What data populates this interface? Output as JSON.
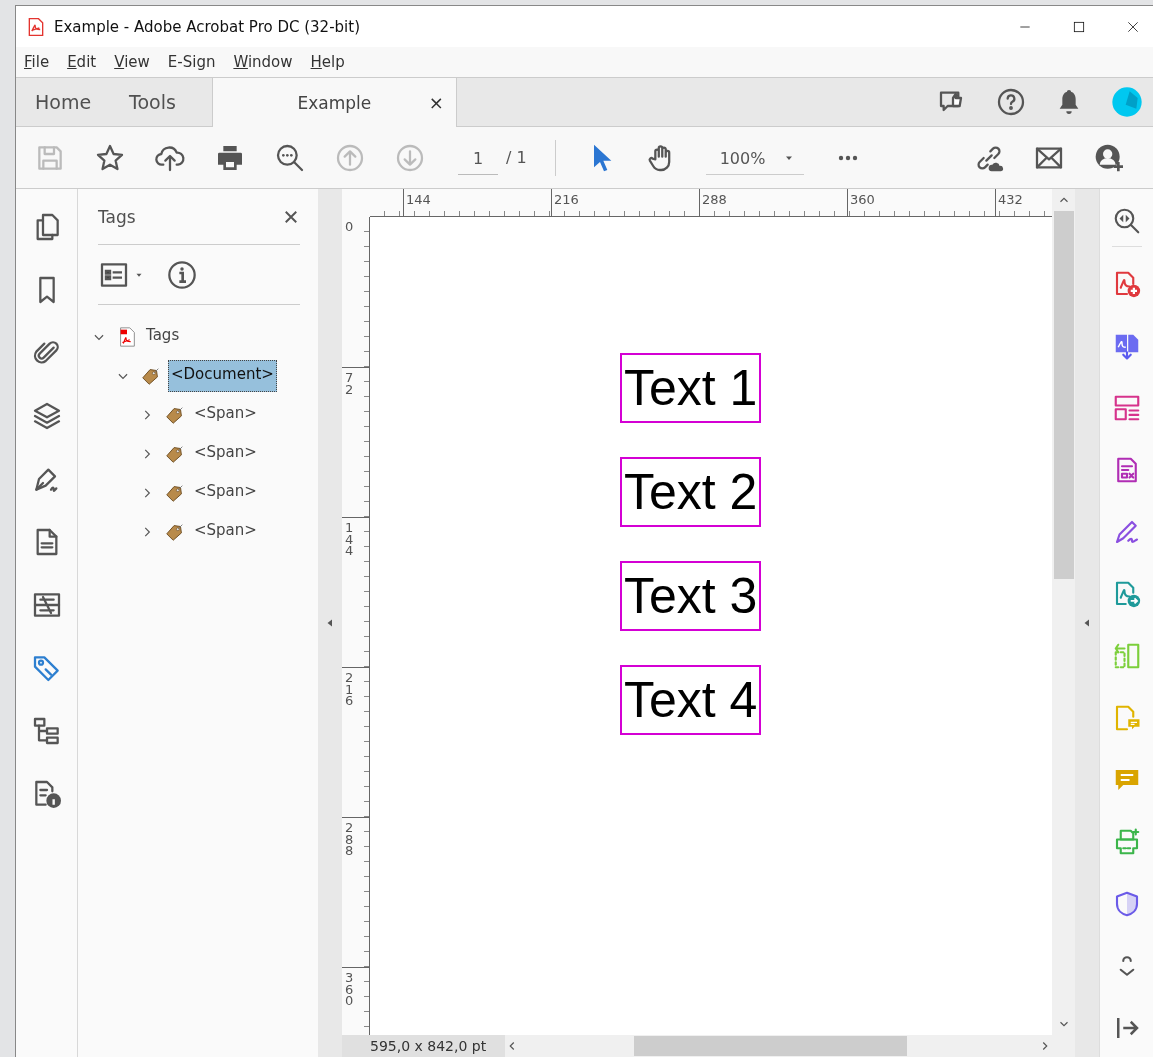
{
  "window": {
    "title": "Example - Adobe Acrobat Pro DC (32-bit)"
  },
  "menu": [
    {
      "label": "File",
      "mnemonic": true
    },
    {
      "label": "Edit",
      "mnemonic": true
    },
    {
      "label": "View",
      "mnemonic": true
    },
    {
      "label": "E-Sign",
      "mnemonic": false
    },
    {
      "label": "Window",
      "mnemonic": true
    },
    {
      "label": "Help",
      "mnemonic": true
    }
  ],
  "tabs": [
    {
      "label": "Home",
      "selected": false
    },
    {
      "label": "Tools",
      "selected": false
    },
    {
      "label": "Example",
      "selected": true,
      "close": "×"
    }
  ],
  "tab_bar_icons": [
    {
      "kind": "feedback"
    },
    {
      "kind": "help"
    },
    {
      "kind": "bell"
    },
    {
      "kind": "avatar"
    }
  ],
  "toolbar": {
    "left": [
      {
        "kind": "save",
        "disabled": true
      },
      {
        "kind": "star",
        "disabled": false
      },
      {
        "kind": "upload",
        "disabled": false
      },
      {
        "kind": "print",
        "disabled": false
      },
      {
        "kind": "zoom-search",
        "disabled": false
      },
      {
        "kind": "prev-page",
        "disabled": true
      },
      {
        "kind": "next-page",
        "disabled": true
      }
    ],
    "page_number": "1",
    "page_total": "/ 1",
    "tools": [
      {
        "kind": "select",
        "selected": true
      },
      {
        "kind": "hand",
        "selected": false
      }
    ],
    "zoom": "100%",
    "right": [
      {
        "kind": "link"
      },
      {
        "kind": "mail"
      },
      {
        "kind": "add-user"
      }
    ]
  },
  "left_rail": [
    {
      "kind": "pages",
      "selected": false
    },
    {
      "kind": "bookmark",
      "selected": false
    },
    {
      "kind": "attachment",
      "selected": false
    },
    {
      "kind": "layers",
      "selected": false
    },
    {
      "kind": "signature",
      "selected": false
    },
    {
      "kind": "document",
      "selected": false
    },
    {
      "kind": "content",
      "selected": false
    },
    {
      "kind": "tags",
      "selected": true
    },
    {
      "kind": "order",
      "selected": false
    },
    {
      "kind": "info",
      "selected": false
    }
  ],
  "tags_panel": {
    "title": "Tags",
    "tree": [
      {
        "label": "Tags",
        "kind": "root",
        "expanded": true,
        "selected": false,
        "children": [
          {
            "label": "<Document>",
            "kind": "tag",
            "expanded": true,
            "selected": true,
            "children": [
              {
                "label": "<Span>",
                "kind": "tag",
                "expanded": false,
                "selected": false
              },
              {
                "label": "<Span>",
                "kind": "tag",
                "expanded": false,
                "selected": false
              },
              {
                "label": "<Span>",
                "kind": "tag",
                "expanded": false,
                "selected": false
              },
              {
                "label": "<Span>",
                "kind": "tag",
                "expanded": false,
                "selected": false
              }
            ]
          }
        ]
      }
    ]
  },
  "document": {
    "h_ruler": [
      "144",
      "216",
      "288",
      "360",
      "432"
    ],
    "v_ruler": [
      "0",
      "72",
      "144",
      "216",
      "288",
      "360"
    ],
    "texts": [
      "Text 1",
      "Text 2",
      "Text 3",
      "Text 4"
    ],
    "status": "595,0 x 842,0 pt"
  },
  "right_rail": [
    {
      "kind": "zoom"
    },
    {
      "kind": "create-pdf"
    },
    {
      "kind": "export"
    },
    {
      "kind": "organize"
    },
    {
      "kind": "forms"
    },
    {
      "kind": "fill-sign"
    },
    {
      "kind": "send"
    },
    {
      "kind": "scan"
    },
    {
      "kind": "comment-file"
    },
    {
      "kind": "comment"
    },
    {
      "kind": "print-production"
    },
    {
      "kind": "protect"
    },
    {
      "kind": "more"
    }
  ]
}
